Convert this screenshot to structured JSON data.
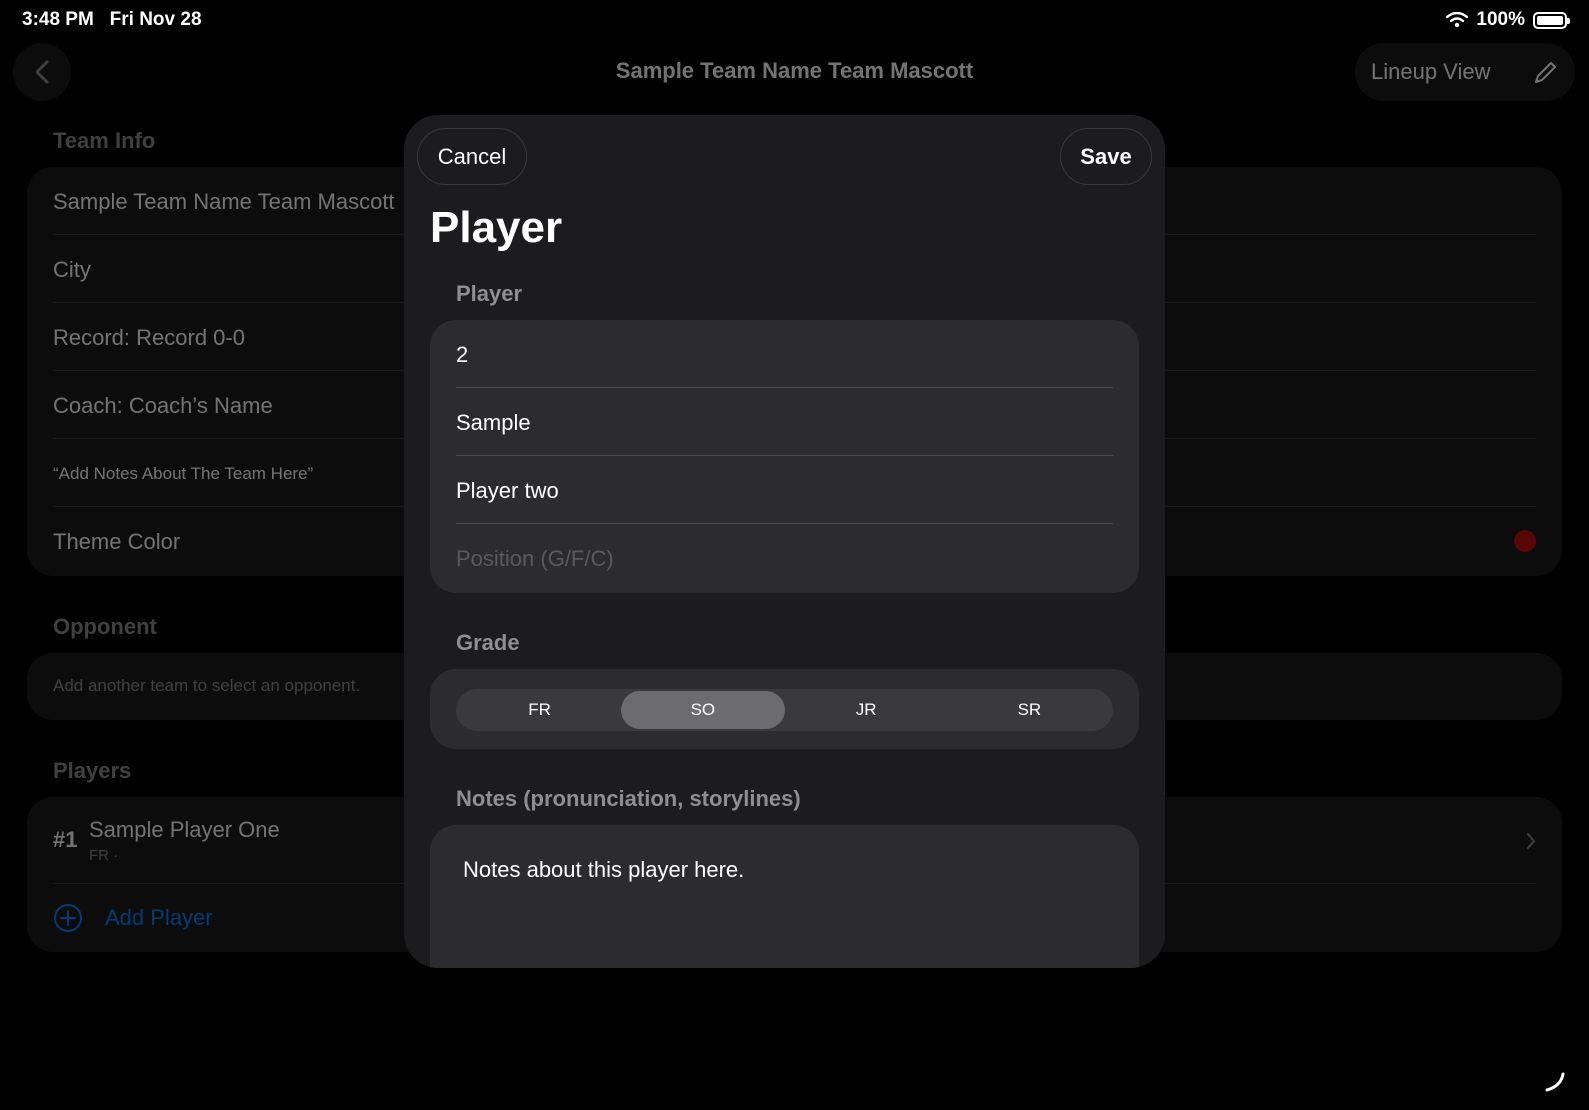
{
  "status_bar": {
    "time": "3:48 PM",
    "date": "Fri Nov 28",
    "battery": "100%"
  },
  "nav": {
    "title": "Sample Team Name Team Mascott",
    "lineup_label": "Lineup View"
  },
  "team_info": {
    "header": "Team Info",
    "name": "Sample Team Name Team Mascott",
    "city": "City",
    "record": "Record: Record 0-0",
    "coach": "Coach: Coach’s Name",
    "notes": "“Add Notes About The Team Here”",
    "theme_label": "Theme Color",
    "theme_color": "#c0100e"
  },
  "opponent": {
    "header": "Opponent",
    "hint": "Add another team to select an opponent."
  },
  "players": {
    "header": "Players",
    "items": [
      {
        "number": "#1",
        "name": "Sample Player One",
        "detail": "FR ·"
      }
    ],
    "add_label": "Add Player",
    "accent": "#0a84ff"
  },
  "sheet": {
    "cancel_label": "Cancel",
    "save_label": "Save",
    "title": "Player",
    "player_section": "Player",
    "fields": {
      "number": "2",
      "first_name": "Sample",
      "last_name": "Player two",
      "position_placeholder": "Position (G/F/C)"
    },
    "grade_section": "Grade",
    "grades": [
      "FR",
      "SO",
      "JR",
      "SR"
    ],
    "selected_grade": "SO",
    "notes_section": "Notes (pronunciation, storylines)",
    "notes_value": "Notes about this player here."
  }
}
